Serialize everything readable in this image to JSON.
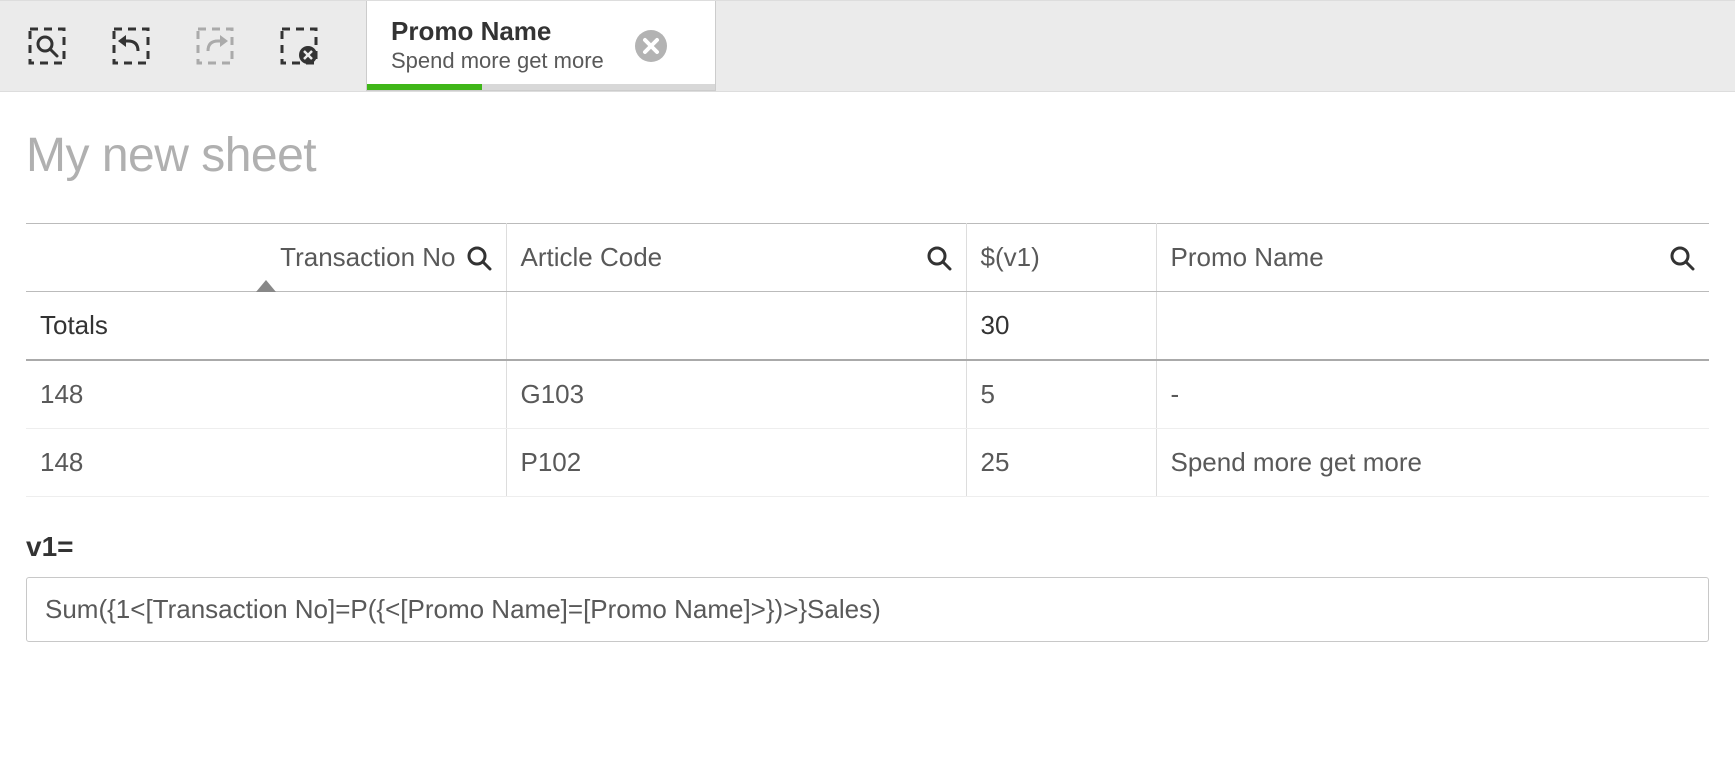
{
  "toolbar": {
    "filter": {
      "title": "Promo Name",
      "value": "Spend more get more"
    }
  },
  "sheet": {
    "title": "My new sheet"
  },
  "table": {
    "headers": {
      "transaction": "Transaction No",
      "article": "Article Code",
      "v1": "$(v1)",
      "promo": "Promo Name"
    },
    "totals_label": "Totals",
    "totals_v1": "30",
    "rows": [
      {
        "transaction": "148",
        "article": "G103",
        "v1": "5",
        "promo": "-"
      },
      {
        "transaction": "148",
        "article": "P102",
        "v1": "25",
        "promo": "Spend more get more"
      }
    ]
  },
  "variable": {
    "label": "v1=",
    "expression": "Sum({1<[Transaction No]=P({<[Promo Name]=[Promo Name]>})>}Sales)"
  }
}
